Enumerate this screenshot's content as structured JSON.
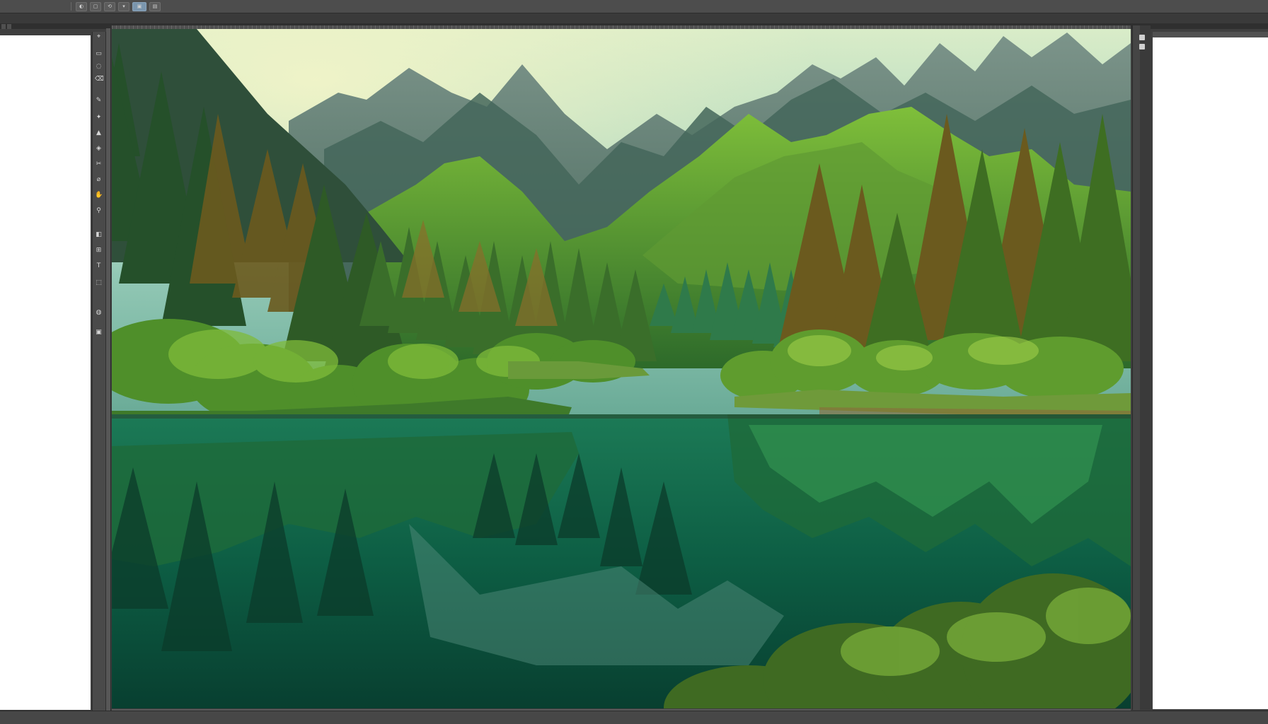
{
  "menubar": {
    "items": [
      "",
      "",
      "",
      "",
      "",
      "",
      "",
      "",
      "",
      "",
      "",
      "",
      "",
      ""
    ],
    "toolbar_buttons": [
      "◐",
      "▢",
      "⟲",
      "▾",
      "▣",
      "▤"
    ]
  },
  "options_bar": {
    "items": [
      "",
      "",
      "",
      "",
      "",
      "",
      ""
    ]
  },
  "document_tabs": [
    "",
    ""
  ],
  "canvas": {
    "image_subject": "mountain-lake-forest-landscape",
    "colors": {
      "sky_top": "#cfe6c4",
      "sky_bottom": "#7fb7a7",
      "mountain_far": "#5c7a6a",
      "forest_dark": "#1f4a2a",
      "forest_bright": "#6fae3a",
      "water": "#0f6a4f",
      "trunk_brown": "#7a5a25"
    }
  },
  "tools": [
    "⌖",
    "▭",
    "◌",
    "⌫",
    "✎",
    "✦",
    "▲",
    "◈",
    "✂",
    "⌀",
    "✋",
    "⚲",
    "◧",
    "⊞",
    "T",
    "⬚",
    "◍",
    "▣"
  ],
  "statusbar": {
    "items": [
      "",
      "",
      ""
    ]
  }
}
